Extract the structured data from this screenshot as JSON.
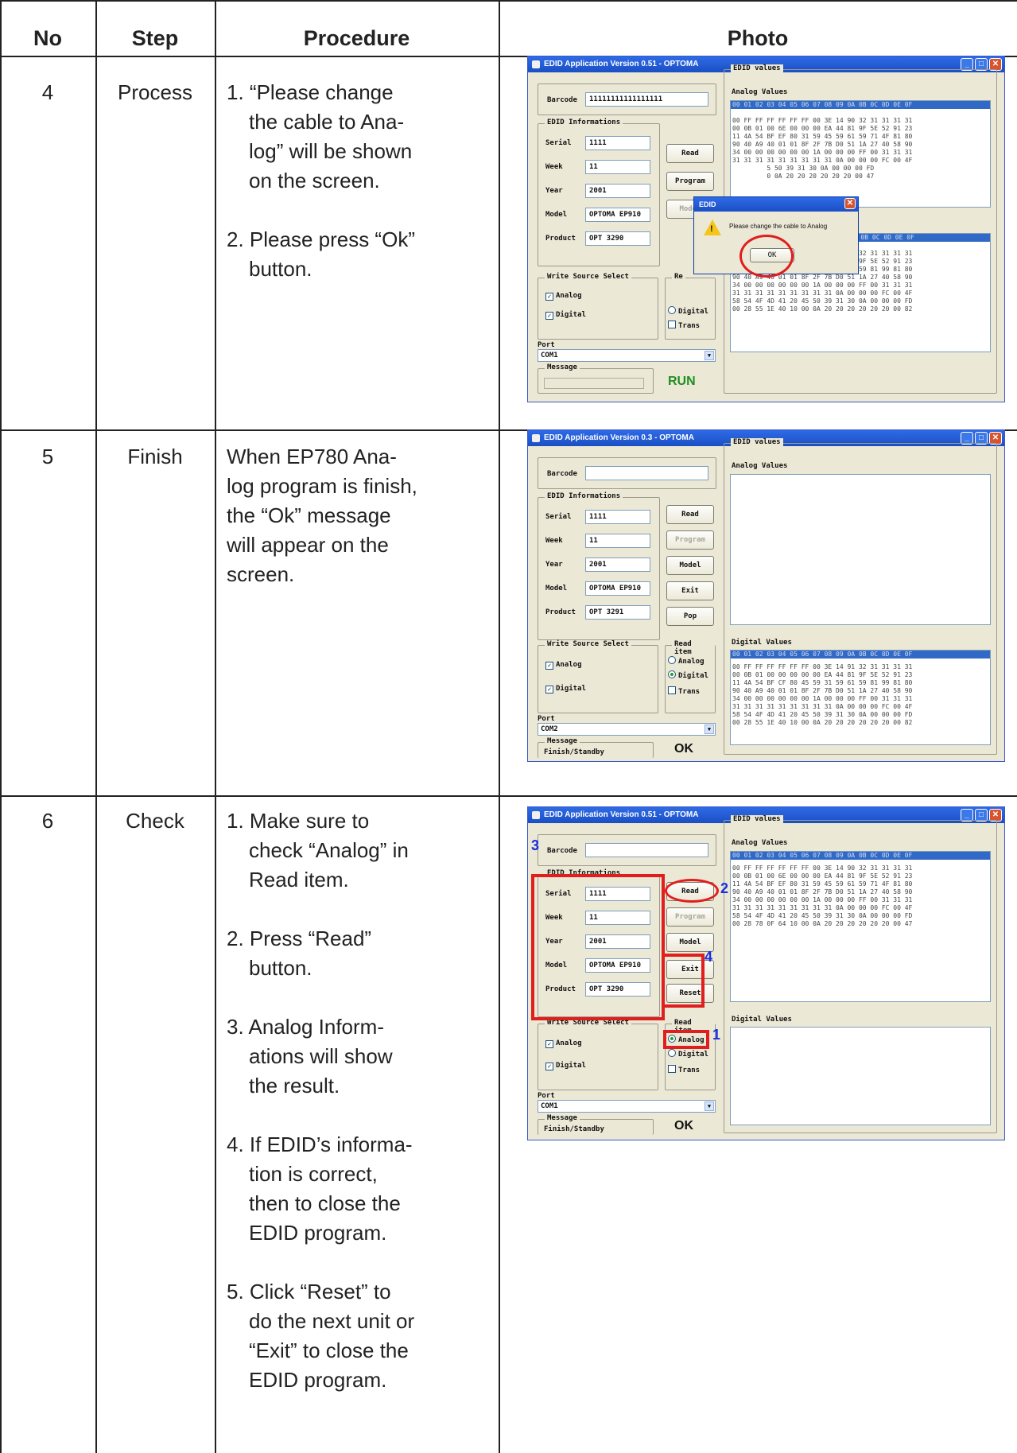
{
  "table": {
    "headers": {
      "no": "No",
      "step": "Step",
      "procedure": "Procedure",
      "photo": "Photo"
    },
    "rows": [
      {
        "no": "4",
        "step": "Process",
        "procedure": [
          {
            "first": "1. “Please change",
            "rest": [
              "the cable to Ana-",
              "log” will be shown",
              "on the screen."
            ]
          },
          {
            "first": "2. Please press “Ok”",
            "rest": [
              "button."
            ]
          }
        ]
      },
      {
        "no": "5",
        "step": "Finish",
        "procedure": [
          {
            "first": "When EP780 Ana-",
            "rest": [
              "log program is finish,",
              "the “Ok” message",
              "will appear on the",
              "screen."
            ],
            "plain": true
          }
        ]
      },
      {
        "no": "6",
        "step": "Check",
        "procedure": [
          {
            "first": "1. Make sure to",
            "rest": [
              "check “Analog” in",
              "Read item."
            ]
          },
          {
            "first": "2. Press “Read”",
            "rest": [
              "button."
            ]
          },
          {
            "first": "3. Analog Inform-",
            "rest": [
              "ations will show",
              "the result."
            ]
          },
          {
            "first": "4. If EDID’s informa-",
            "rest": [
              "tion is correct,",
              "then to close the",
              "EDID program."
            ]
          },
          {
            "first": "5. Click “Reset” to",
            "rest": [
              "do the next unit or",
              "“Exit” to close the",
              "EDID program."
            ]
          }
        ]
      }
    ]
  },
  "screens": [
    {
      "title": "EDID Application Version 0.51 - OPTOMA",
      "barcode_label": "Barcode",
      "barcode_value": "11111111111111111",
      "info_group": "EDID Informations",
      "serial_label": "Serial",
      "serial": "1111",
      "week_label": "Week",
      "week": "11",
      "year_label": "Year",
      "year": "2001",
      "model_label": "Model",
      "model": "OPTOMA EP910",
      "product_label": "Product",
      "product": "OPT 3290",
      "buttons": [
        "Read",
        "Program",
        "Model"
      ],
      "write_group": "Write Source Select",
      "analog": "Analog",
      "digital": "Digital",
      "read_group": "Re",
      "read_digital": "Digital",
      "read_trans": "Trans",
      "port_label": "Port",
      "port": "COM1",
      "message_label": "Message",
      "message": "",
      "status": "RUN",
      "values_group": "EDID values",
      "analog_values": "Analog Values",
      "hex_header": "00 01 02 03 04 05 06 07 08 09 0A 0B 0C 0D 0E 0F",
      "hex_header2": "6 07 08 09 0A 0B 0C 0D 0E 0F",
      "analog_rows": [
        "00 FF FF FF FF FF FF 00 3E 14 90 32 31 31 31 31",
        "00 0B 01 00 6E 00 00 00 EA 44 81 9F 5E 52 91 23",
        "11 4A 54 BF EF 80 31 59 45 59 61 59 71 4F 81 80",
        "90 40 A9 40 01 01 8F 2F 7B D0 51 1A 27 40 58 90",
        "34 00 00 00 00 00 00 1A 00 00 00 FF 00 31 31 31",
        "31 31 31 31 31 31 31 31 31 0A 00 00 00 FC 00 4F",
        "         5 50 39 31 30 0A 00 00 00 FD",
        "         0 0A 20 20 20 20 20 20 00 47"
      ],
      "digital_rows": [
        "00 FF FF FF FF FF FF 00 3E 14 91 32 31 31 31 31",
        "00 0B 01 00 00 00 00 00 EA 44 81 9F 5E 52 91 23",
        "11 4A 54 BF CF 80 45 59 31 59 61 59 81 99 81 80",
        "90 40 A9 40 01 01 8F 2F 7B D0 51 1A 27 40 58 90",
        "34 00 00 00 00 00 00 1A 00 00 00 FF 00 31 31 31",
        "31 31 31 31 31 31 31 31 31 0A 00 00 00 FC 00 4F",
        "58 54 4F 4D 41 20 45 50 39 31 30 0A 00 00 00 FD",
        "00 28 55 1E 40 10 00 0A 20 20 20 20 20 20 00 82"
      ],
      "dialog_title": "EDID",
      "dialog_text": "Please change the cable to Analog",
      "dialog_ok": "OK"
    },
    {
      "title": "EDID Application Version 0.3 - OPTOMA",
      "barcode_label": "Barcode",
      "barcode_value": "",
      "info_group": "EDID Informations",
      "serial_label": "Serial",
      "serial": "1111",
      "week_label": "Week",
      "week": "11",
      "year_label": "Year",
      "year": "2001",
      "model_label": "Model",
      "model": "OPTOMA EP910",
      "product_label": "Product",
      "product": "OPT 3291",
      "buttons": [
        "Read",
        "Program",
        "Model",
        "Exit",
        "Pop"
      ],
      "write_group": "Write Source Select",
      "analog": "Analog",
      "digital": "Digital",
      "read_group": "Read item",
      "read_analog": "Analog",
      "read_digital": "Digital",
      "read_trans": "Trans",
      "port_label": "Port",
      "port": "COM2",
      "message_label": "Message",
      "message": "Finish/Standby",
      "status": "OK",
      "values_group": "EDID values",
      "analog_values": "Analog Values",
      "digital_values": "Digital Values",
      "hex_header": "00 01 02 03 04 05 06 07 08 09 0A 0B 0C 0D 0E 0F",
      "digital_rows": [
        "00 FF FF FF FF FF FF 00 3E 14 91 32 31 31 31 31",
        "00 0B 01 00 00 00 00 00 EA 44 81 9F 5E 52 91 23",
        "11 4A 54 BF CF 80 45 59 31 59 61 59 81 99 81 80",
        "90 40 A9 40 01 01 8F 2F 7B D0 51 1A 27 40 58 90",
        "34 00 00 00 00 00 00 1A 00 00 00 FF 00 31 31 31",
        "31 31 31 31 31 31 31 31 31 0A 00 00 00 FC 00 4F",
        "58 54 4F 4D 41 20 45 50 39 31 30 0A 00 00 00 FD",
        "00 28 55 1E 40 10 00 0A 20 20 20 20 20 20 00 82"
      ]
    },
    {
      "title": "EDID Application Version 0.51 - OPTOMA",
      "barcode_label": "Barcode",
      "barcode_value": "",
      "info_group": "EDID Informations",
      "serial_label": "Serial",
      "serial": "1111",
      "week_label": "Week",
      "week": "11",
      "year_label": "Year",
      "year": "2001",
      "model_label": "Model",
      "model": "OPTOMA EP910",
      "product_label": "Product",
      "product": "OPT 3290",
      "buttons": [
        "Read",
        "Program",
        "Model",
        "Exit",
        "Reset"
      ],
      "write_group": "Write Source Select",
      "analog": "Analog",
      "digital": "Digital",
      "read_group": "Read item",
      "read_analog": "Analog",
      "read_digital": "Digital",
      "read_trans": "Trans",
      "port_label": "Port",
      "port": "COM1",
      "message_label": "Message",
      "message": "Finish/Standby",
      "status": "OK",
      "values_group": "EDID values",
      "analog_values": "Analog Values",
      "digital_values": "Digital Values",
      "hex_header": "00 01 02 03 04 05 06 07 08 09 0A 0B 0C 0D 0E 0F",
      "analog_rows": [
        "00 FF FF FF FF FF FF 00 3E 14 90 32 31 31 31 31",
        "00 0B 01 00 6E 00 00 00 EA 44 81 9F 5E 52 91 23",
        "11 4A 54 BF EF 80 31 59 45 59 61 59 71 4F 81 80",
        "90 40 A9 40 01 01 8F 2F 7B D0 51 1A 27 40 58 90",
        "34 00 00 00 00 00 00 1A 00 00 00 FF 00 31 31 31",
        "31 31 31 31 31 31 31 31 31 0A 00 00 00 FC 00 4F",
        "58 54 4F 4D 41 20 45 50 39 31 30 0A 00 00 00 FD",
        "00 28 78 0F 64 10 00 0A 20 20 20 20 20 20 00 47"
      ],
      "markers": [
        "1",
        "2",
        "3",
        "4"
      ]
    }
  ],
  "colors": {
    "highlight": "#e01e1e",
    "marker_number": "#1a2ee0",
    "titlebar": "#2458d6",
    "window_bg": "#ece8d6",
    "list_header": "#3169c6"
  }
}
